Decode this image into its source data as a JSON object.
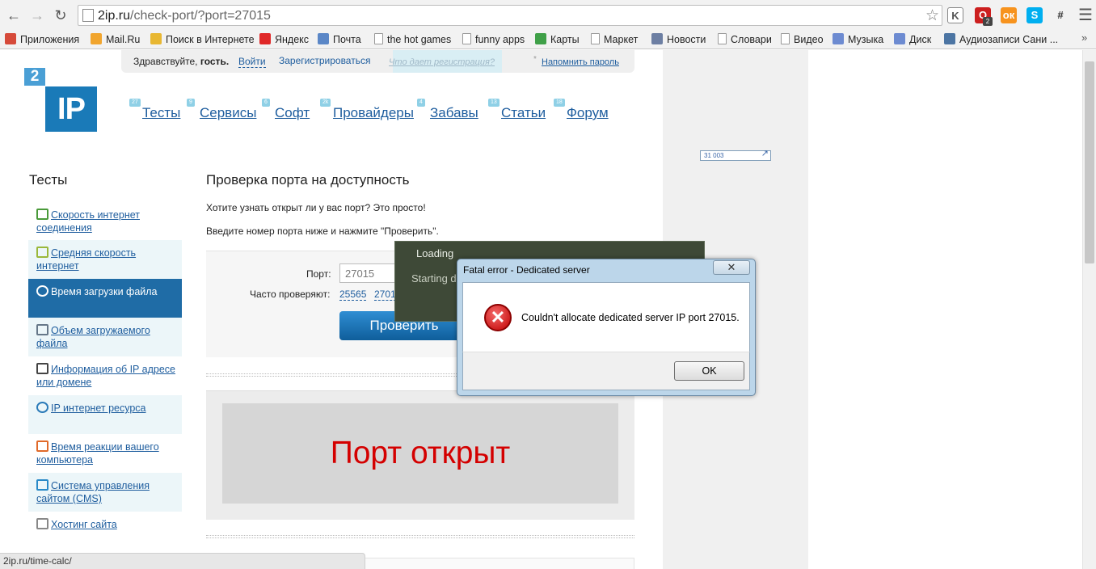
{
  "browser": {
    "url_host": "2ip.ru",
    "url_path": "/check-port/?port=27015",
    "extensions": [
      {
        "name": "kaspersky-icon",
        "label": "K",
        "color": "#ffffff",
        "fg": "#555555"
      },
      {
        "name": "opera-adblock-icon",
        "label": "O",
        "color": "#cc1f1f",
        "fg": "#ffffff",
        "badge": "2"
      },
      {
        "name": "odnoklassniki-icon",
        "label": "ок",
        "color": "#f7931e",
        "fg": "#ffffff"
      },
      {
        "name": "skype-icon",
        "label": "S",
        "color": "#00aff0",
        "fg": "#ffffff"
      },
      {
        "name": "hash-icon",
        "label": "#",
        "color": "#f2f2f2",
        "fg": "#333333"
      }
    ]
  },
  "bookmarks": [
    {
      "label": "Приложения",
      "icon": "apps-grid-icon",
      "color": "#d64a3a"
    },
    {
      "label": "Mail.Ru",
      "icon": "mailru-icon",
      "color": "#f1a52e"
    },
    {
      "label": "Поиск в Интернете",
      "icon": "search-globe-icon",
      "color": "#e8b732"
    },
    {
      "label": "Яндекс",
      "icon": "yandex-icon",
      "color": "#e02828"
    },
    {
      "label": "Почта",
      "icon": "mail-icon",
      "color": "#5b87c7"
    },
    {
      "label": "the hot games",
      "icon": "page-icon",
      "color": ""
    },
    {
      "label": "funny apps",
      "icon": "page-icon",
      "color": ""
    },
    {
      "label": "Карты",
      "icon": "maps-icon",
      "color": "#3fa048"
    },
    {
      "label": "Маркет",
      "icon": "page-icon",
      "color": ""
    },
    {
      "label": "Новости",
      "icon": "news-icon",
      "color": "#6d7fa3"
    },
    {
      "label": "Словари",
      "icon": "page-icon",
      "color": ""
    },
    {
      "label": "Видео",
      "icon": "page-icon",
      "color": ""
    },
    {
      "label": "Музыка",
      "icon": "music-icon",
      "color": "#6d8bd1"
    },
    {
      "label": "Диск",
      "icon": "disk-icon",
      "color": "#6d8bd1"
    },
    {
      "label": "Аудиозаписи Сани ...",
      "icon": "vk-icon",
      "color": "#4c75a3"
    }
  ],
  "header": {
    "greeting_prefix": "Здравствуйте,",
    "greeting_user": "гость.",
    "login": "Войти",
    "register": "Зарегистрироваться",
    "register_hint": "Что дает регистрация?",
    "remind_password": "Напомнить пароль",
    "logo_small": "2",
    "logo_big": "IP"
  },
  "nav": [
    {
      "label": "Тесты",
      "badge": "27"
    },
    {
      "label": "Сервисы",
      "badge": "9"
    },
    {
      "label": "Софт",
      "badge": "6"
    },
    {
      "label": "Провайдеры",
      "badge": "2k"
    },
    {
      "label": "Забавы",
      "badge": "4"
    },
    {
      "label": "Статьи",
      "badge": "13"
    },
    {
      "label": "Форум",
      "badge": "18"
    }
  ],
  "counter": "31 003",
  "menu": {
    "title": "Тесты",
    "items": [
      {
        "label": "Скорость интернет соединения",
        "icon": "speed-arrow-icon"
      },
      {
        "label": "Средняя скорость интернет",
        "icon": "bars-icon"
      },
      {
        "label": "Время загрузки файла",
        "icon": "clock-icon"
      },
      {
        "label": "Объем загружаемого файла",
        "icon": "file-size-icon"
      },
      {
        "label": "Информация об IP адресе или домене",
        "icon": "ip-info-icon"
      },
      {
        "label": "IP интернет ресурса",
        "icon": "ip-globe-icon"
      },
      {
        "label": "Время реакции вашего компьютера",
        "icon": "reaction-icon"
      },
      {
        "label": "Система управления сайтом (CMS)",
        "icon": "cms-icon"
      },
      {
        "label": "Хостинг сайта",
        "icon": "hosting-icon"
      }
    ]
  },
  "main": {
    "title": "Проверка порта на доступность",
    "intro": "Хотите узнать открыт ли у вас порт? Это просто!",
    "instruction": "Введите номер порта ниже и нажмите \"Проверить\".",
    "port_label": "Порт:",
    "port_value": "27015",
    "often_label": "Часто проверяют:",
    "often_ports": [
      "25565",
      "2701"
    ],
    "check_button": "Проверить",
    "result": "Порт открыт"
  },
  "status_url": "2ip.ru/time-calc/",
  "loading": {
    "title": "Loading",
    "status": "Starting d"
  },
  "dialog": {
    "title": "Fatal error - Dedicated server",
    "close": "✕",
    "message": "Couldn't allocate dedicated server IP port 27015.",
    "ok": "OK",
    "icon_glyph": "✕"
  }
}
